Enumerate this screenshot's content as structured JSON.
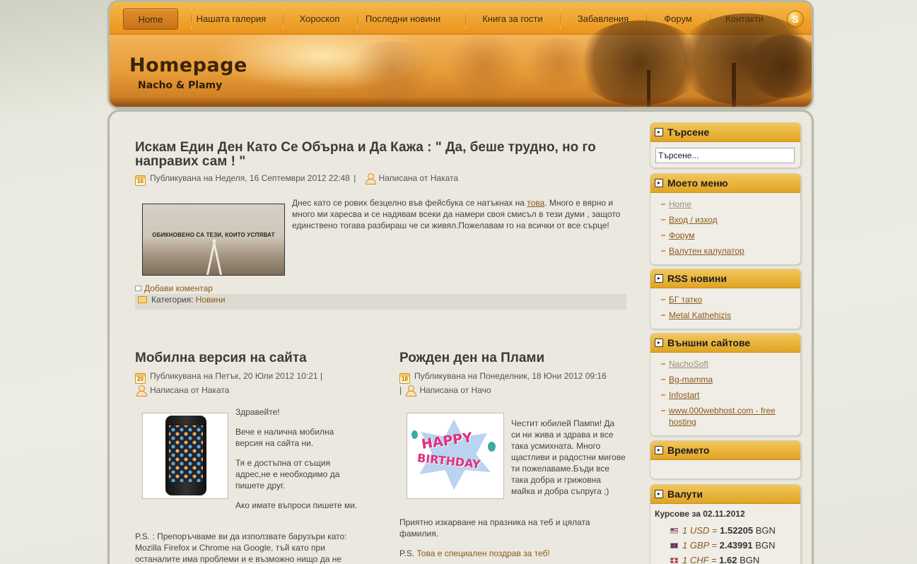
{
  "nav": {
    "items": [
      "Home",
      "Нашата галерия",
      "Хороскоп",
      "Последни новини",
      "Книга за гости",
      "Забавления",
      "Форум",
      "Контакти"
    ],
    "active_index": 0
  },
  "header": {
    "title": "Homepage",
    "subtitle": "Nacho & Plamy"
  },
  "post1": {
    "title": "Искам Един Ден Като Се Обърна и Да Кажа : \" Да, беше трудно, но го направих сам ! \"",
    "cal_day": "16",
    "published": "Публикувана на Неделя, 16 Септември 2012 22:48",
    "sep": "|",
    "author": "Написана от Наката",
    "thumb_text": "ОБИКНОВЕНО СА ТЕЗИ, КОИТО УСПЯВАТ",
    "body_before_link": "Днес като се рових безцелно във фейсбука се натъкнах на ",
    "link": "това",
    "body_after_link": ". Много е вярно и много ми харесва и се надявам всеки да намери своя смисъл в тези думи , защото единствено тогава разбираш че си живял.Пожелавам го на всички от все сърце!",
    "add_comment": "Добави коментар",
    "category_label": "Категория:",
    "category": "Новини"
  },
  "post2": {
    "title": "Мобилна версия на сайта",
    "cal_day": "20",
    "published": "Публикувана на Петък, 20 Юли 2012 10:21",
    "sep": "|",
    "author": "Написана от Наката",
    "p1": "Здравейте!",
    "p2": "Вече е налична мобилна версия на сайта ни.",
    "p3": "Тя е достъпна от същия адрес,не е необходимо да пишете друг.",
    "p4": "Ако имате въпроси пишете ми.",
    "p5": "P.S. : Препоръчваме ви да използвате барузъри като: Mozilla Firefox и Chrome на Google, тъй като при останалите има проблеми и е възможно нищо да не"
  },
  "post3": {
    "title": "Рожден ден на Плами",
    "cal_day": "18",
    "published": "Публикувана на Понеделник, 18 Юни 2012 09:16",
    "sep": "|",
    "author": "Написана от Начо",
    "thumb_text_1": "HAPPY",
    "thumb_text_2": "BIRTHDAY",
    "p1": "Честит юбилей Пампи! Да си ни жива и здрава и все така усмихната. Много щастливи и  радостни мигове ти пожелаваме.Бъди все така добра и грижовна майка и добра съпруга ;)",
    "p2": "Приятно изкарване на празника на теб и цялата фамилия.",
    "p3_prefix": "P.S. ",
    "p3_link": "Това е специален поздрав за теб!"
  },
  "sidebar": {
    "search": {
      "title": "Търсене",
      "placeholder": "Търсене..."
    },
    "menu": {
      "title": "Моето меню",
      "items": [
        "Home",
        "Вход / изход",
        "Форум",
        "Валутен калулатор"
      ]
    },
    "rss": {
      "title": "RSS новини",
      "items": [
        "БГ татко",
        "Metal Kathehizis"
      ]
    },
    "external": {
      "title": "Външни сайтове",
      "items": [
        "NachoSoft",
        "Bg-mamma",
        "Infostart",
        "www.000webhost.com - free hosting"
      ]
    },
    "weather": {
      "title": "Времето"
    },
    "currency": {
      "title": "Валути",
      "date_label": "Курсове за 02.11.2012",
      "rates": [
        {
          "unit": "1 USD =",
          "value": "1.52205",
          "cur": "BGN",
          "flag": "us-flag-icon"
        },
        {
          "unit": "1 GBP =",
          "value": "2.43991",
          "cur": "BGN",
          "flag": "uk-flag-icon"
        },
        {
          "unit": "1 CHF =",
          "value": "1.62",
          "cur": "BGN",
          "flag": "ch-flag-icon"
        }
      ]
    }
  }
}
